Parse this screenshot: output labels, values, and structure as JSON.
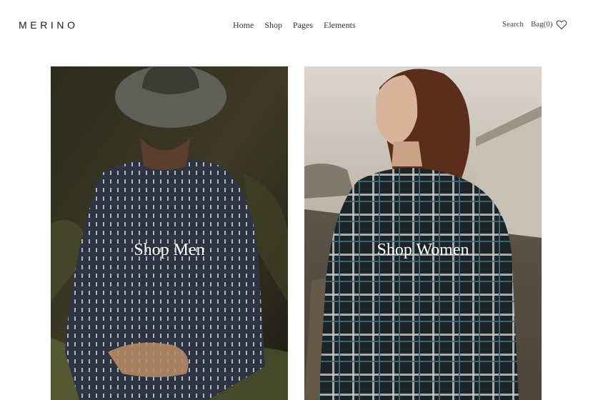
{
  "brand": "MERINO",
  "nav": [
    "Home",
    "Shop",
    "Pages",
    "Elements"
  ],
  "tools": {
    "search": "Search",
    "bag": "Bag",
    "bag_count": "(0)",
    "wishlist_icon": "heart-icon"
  },
  "cards": [
    {
      "label": "Shop Men"
    },
    {
      "label": "Shop Women"
    }
  ]
}
